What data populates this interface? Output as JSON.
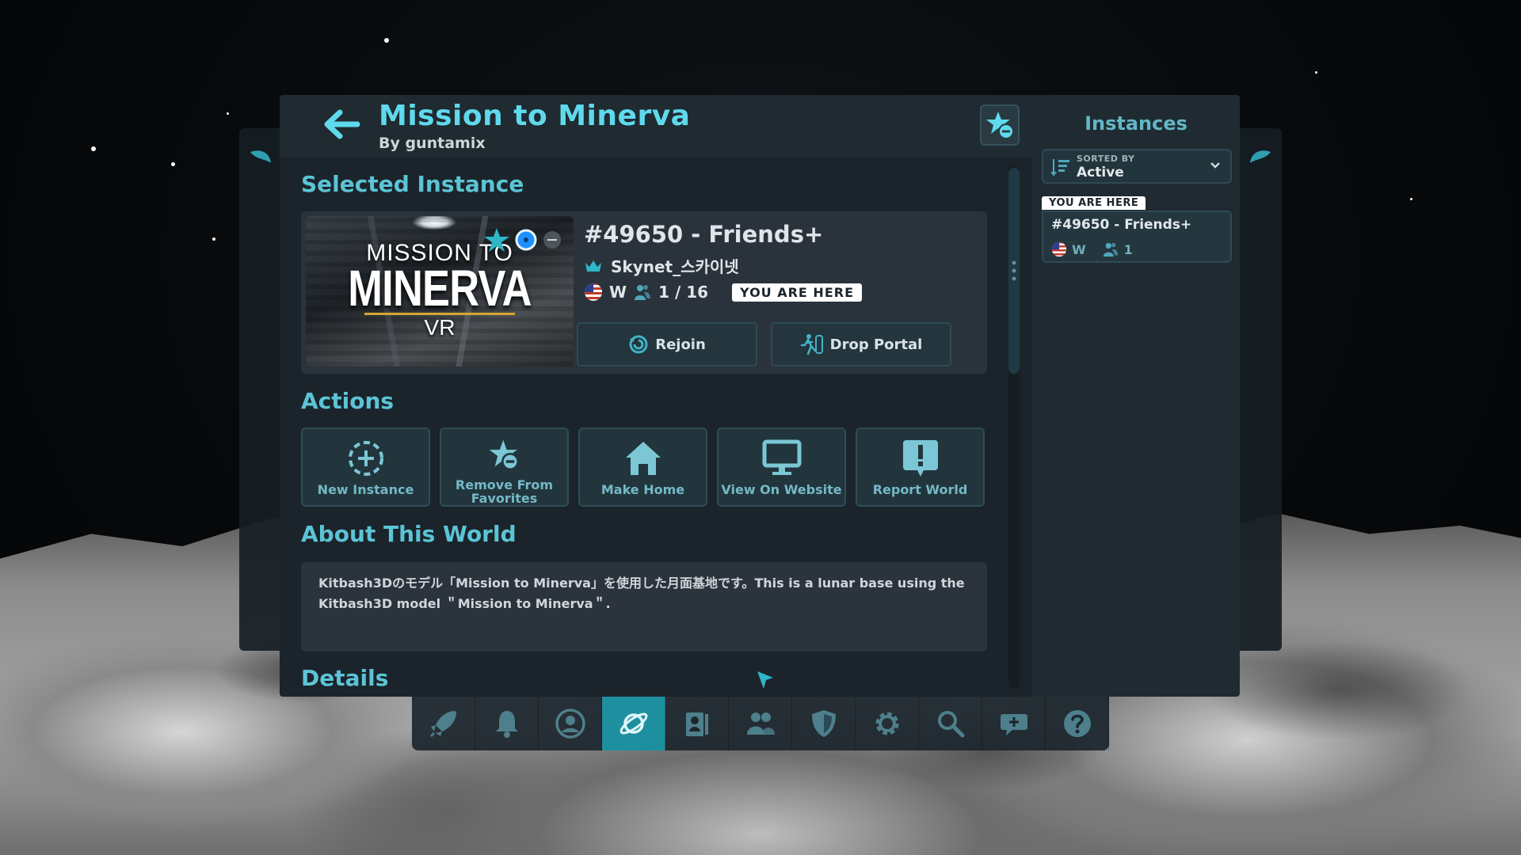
{
  "header": {
    "title": "Mission to Minerva",
    "author": "By guntamix"
  },
  "selected_instance": {
    "section_title": "Selected Instance",
    "thumbnail_logo": {
      "line1": "MISSION TO",
      "line2": "MINERVA",
      "line3": "VR"
    },
    "name": "#49650 - Friends+",
    "owner": "Skynet_스카이넷",
    "region": "W",
    "users": "1 / 16",
    "badge": "YOU ARE HERE",
    "rejoin_label": "Rejoin",
    "drop_portal_label": "Drop Portal"
  },
  "actions": {
    "section_title": "Actions",
    "items": [
      {
        "label": "New Instance",
        "icon": "new-instance-icon"
      },
      {
        "label": "Remove From Favorites",
        "icon": "remove-favorite-icon"
      },
      {
        "label": "Make Home",
        "icon": "home-icon"
      },
      {
        "label": "View On Website",
        "icon": "monitor-icon"
      },
      {
        "label": "Report World",
        "icon": "report-icon"
      }
    ]
  },
  "about": {
    "section_title": "About This World",
    "text": "Kitbash3Dのモデル「Mission to Minerva」を使用した月面基地です。This is a lunar base using the Kitbash3D model ＂Mission to Minerva＂."
  },
  "details": {
    "section_title": "Details"
  },
  "instances_panel": {
    "title": "Instances",
    "sort_caption": "SORTED BY",
    "sort_value": "Active",
    "badge": "YOU ARE HERE",
    "items": [
      {
        "name": "#49650 - Friends+",
        "region": "W",
        "users": "1"
      }
    ]
  },
  "bottom_nav": {
    "items": [
      "launch-icon",
      "bell-icon",
      "profile-icon",
      "worlds-icon",
      "avatars-icon",
      "social-icon",
      "safety-icon",
      "settings-icon",
      "search-icon",
      "add-chat-icon",
      "help-icon"
    ],
    "active": "worlds-icon"
  },
  "colors": {
    "accent": "#5fd9ec",
    "section_title": "#5bc4d6",
    "active_nav": "#1e8f9f",
    "panel_bg": "#1b242b"
  }
}
